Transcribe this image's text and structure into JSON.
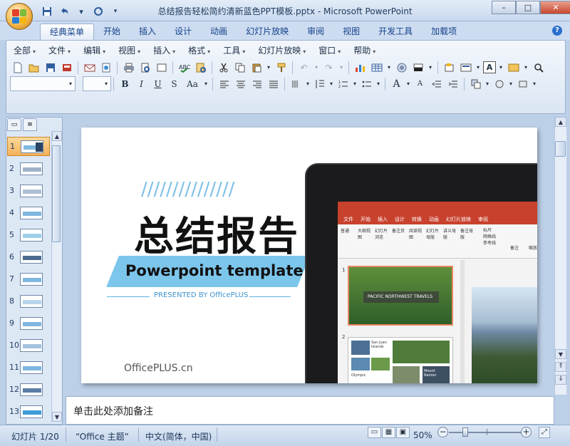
{
  "window": {
    "title": "总结报告轻松简约清新蓝色PPT模板.pptx - Microsoft PowerPoint",
    "controls": [
      "–",
      "□",
      "✕"
    ]
  },
  "qat": {
    "undo_arrow": "▾"
  },
  "ribbon": {
    "tabs": [
      "经典菜单",
      "开始",
      "插入",
      "设计",
      "动画",
      "幻灯片放映",
      "审阅",
      "视图",
      "开发工具",
      "加载项"
    ],
    "help": "?",
    "menus": [
      "全部",
      "文件",
      "编辑",
      "视图",
      "插入",
      "格式",
      "工具",
      "幻灯片放映",
      "窗口",
      "帮助"
    ],
    "format_labels": {
      "bold": "B",
      "italic": "I",
      "underline": "U",
      "strike": "S",
      "case": "Aa",
      "grow": "A",
      "shrink": "A",
      "textbox": "A"
    }
  },
  "slides_pane": {
    "numbers": [
      "1",
      "2",
      "3",
      "4",
      "5",
      "6",
      "7",
      "8",
      "9",
      "10",
      "11",
      "12",
      "13"
    ],
    "selected": "1"
  },
  "slide": {
    "title": "总结报告",
    "subtitle": "Powerpoint template",
    "presented_by": "PRESENTED BY OfficePLUS",
    "logo": "OfficePLUS.cn",
    "stripes": "///////////////",
    "mockup": {
      "tabs": [
        "文件",
        "开始",
        "插入",
        "设计",
        "转换",
        "动画",
        "幻灯片放映",
        "审阅"
      ],
      "tools": [
        "普通",
        "大纲视图",
        "幻灯片浏览",
        "备注页",
        "阅读视图",
        "幻灯片母版",
        "讲义母版",
        "备注母版",
        "备注",
        "缩放"
      ],
      "checks": [
        "标尺",
        "网格线",
        "参考线"
      ],
      "thumb1_caption": "PACIFIC NORTHWEST TRAVELS",
      "thumb2_texts": [
        "San Juan Islands",
        "Olympic",
        "Mount Rainier"
      ],
      "nums": [
        "1",
        "2"
      ]
    }
  },
  "notes": {
    "placeholder": "单击此处添加备注"
  },
  "statusbar": {
    "slide_info": "幻灯片 1/20",
    "theme": "“Office 主题”",
    "language": "中文(简体，中国)",
    "zoom": "50%",
    "zoom_level": 0.5
  },
  "colors": {
    "accent_blue": "#5ab3e3",
    "title_black": "#111111",
    "ribbon_red": "#c8412d",
    "selected_thumb": "#f4b25a"
  }
}
